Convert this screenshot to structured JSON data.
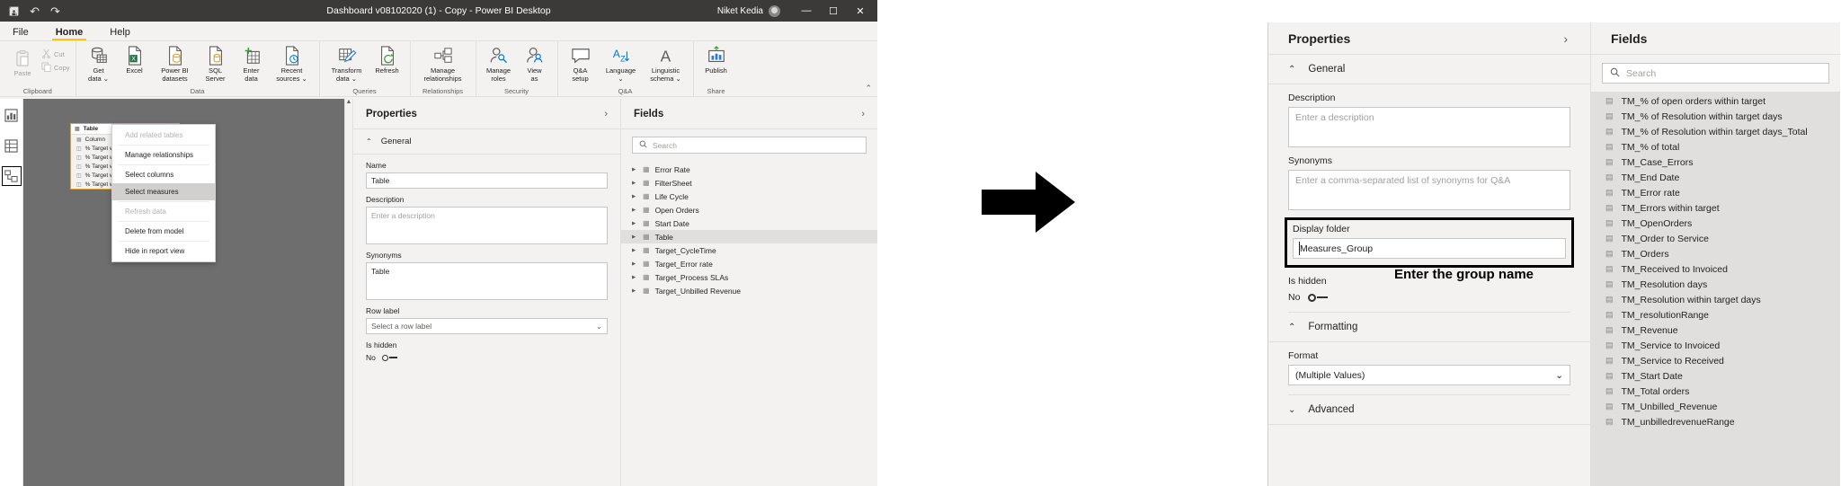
{
  "window": {
    "title": "Dashboard v08102020 (1) - Copy - Power BI Desktop",
    "user": "Niket Kedia",
    "quick_access": [
      "save-icon",
      "undo-icon",
      "redo-icon"
    ],
    "minimize": "—",
    "maximize": "☐",
    "close": "✕"
  },
  "menu": {
    "items": [
      "File",
      "Home",
      "Help"
    ],
    "active": "Home"
  },
  "ribbon": {
    "groups": [
      {
        "label": "Clipboard",
        "type": "clipboard",
        "paste": "Paste",
        "cut": "Cut",
        "copy": "Copy"
      },
      {
        "label": "Data",
        "buttons": [
          {
            "label": "Get\ndata ⌄",
            "icon": "get-data-icon"
          },
          {
            "label": "Excel",
            "icon": "excel-icon"
          },
          {
            "label": "Power BI\ndatasets",
            "icon": "powerbi-datasets-icon"
          },
          {
            "label": "SQL\nServer",
            "icon": "sql-server-icon"
          },
          {
            "label": "Enter\ndata",
            "icon": "enter-data-icon"
          },
          {
            "label": "Recent\nsources ⌄",
            "icon": "recent-sources-icon"
          }
        ]
      },
      {
        "label": "Queries",
        "buttons": [
          {
            "label": "Transform\ndata ⌄",
            "icon": "transform-data-icon"
          },
          {
            "label": "Refresh",
            "icon": "refresh-icon"
          }
        ]
      },
      {
        "label": "Relationships",
        "buttons": [
          {
            "label": "Manage\nrelationships",
            "icon": "manage-relationships-icon"
          }
        ]
      },
      {
        "label": "Security",
        "buttons": [
          {
            "label": "Manage\nroles",
            "icon": "manage-roles-icon"
          },
          {
            "label": "View\nas",
            "icon": "view-as-icon"
          }
        ]
      },
      {
        "label": "Q&A",
        "buttons": [
          {
            "label": "Q&A\nsetup",
            "icon": "qa-setup-icon"
          },
          {
            "label": "Language\n⌄",
            "icon": "language-icon"
          },
          {
            "label": "Linguistic\nschema ⌄",
            "icon": "linguistic-schema-icon"
          }
        ]
      },
      {
        "label": "Share",
        "buttons": [
          {
            "label": "Publish",
            "icon": "publish-icon"
          }
        ]
      }
    ],
    "collapse": "⌃"
  },
  "left_rail": {
    "items": [
      {
        "name": "report-view-icon",
        "glyph": "▤",
        "selected": false
      },
      {
        "name": "data-view-icon",
        "glyph": "▦",
        "selected": false
      },
      {
        "name": "model-view-icon",
        "glyph": "▧",
        "selected": true
      }
    ]
  },
  "model_card": {
    "title": "Table",
    "rows": [
      "Column",
      "% Target with",
      "% Target with",
      "% Target with",
      "% Target with",
      "% Target with"
    ]
  },
  "context_menu": {
    "items": [
      {
        "label": "Add related tables",
        "state": "disabled"
      },
      {
        "label": "Manage relationships",
        "state": "normal"
      },
      {
        "label": "Select columns",
        "state": "normal"
      },
      {
        "label": "Select measures",
        "state": "highlighted"
      },
      {
        "label": "Refresh data",
        "state": "disabled"
      },
      {
        "label": "Delete from model",
        "state": "normal"
      },
      {
        "label": "Hide in report view",
        "state": "normal"
      }
    ]
  },
  "left_properties": {
    "title": "Properties",
    "collapse_chevron": "›",
    "general_label": "General",
    "general_chevron": "⌃",
    "name_label": "Name",
    "name_value": "Table",
    "description_label": "Description",
    "description_placeholder": "Enter a description",
    "synonyms_label": "Synonyms",
    "synonyms_value": "Table",
    "row_label_label": "Row label",
    "row_label_value": "Select a row label",
    "row_label_chevron": "⌄",
    "is_hidden_label": "Is hidden",
    "is_hidden_value": "No"
  },
  "left_fields": {
    "title": "Fields",
    "collapse_chevron": "›",
    "search_placeholder": "Search",
    "search_icon": "search-icon",
    "items": [
      {
        "label": "Error Rate",
        "selected": false
      },
      {
        "label": "FilterSheet",
        "selected": false
      },
      {
        "label": "Life Cycle",
        "selected": false
      },
      {
        "label": "Open Orders",
        "selected": false
      },
      {
        "label": "Start Date",
        "selected": false
      },
      {
        "label": "Table",
        "selected": true
      },
      {
        "label": "Target_CycleTime",
        "selected": false
      },
      {
        "label": "Target_Error rate",
        "selected": false
      },
      {
        "label": "Target_Process SLAs",
        "selected": false
      },
      {
        "label": "Target_Unbilled Revenue",
        "selected": false
      }
    ]
  },
  "right_properties": {
    "title": "Properties",
    "collapse_chevron": "›",
    "general_label": "General",
    "general_chevron": "⌃",
    "description_label": "Description",
    "description_placeholder": "Enter a description",
    "synonyms_label": "Synonyms",
    "synonyms_placeholder": "Enter a comma-separated list of synonyms for Q&A",
    "display_folder_label": "Display folder",
    "display_folder_value": "Measures_Group",
    "is_hidden_label": "Is hidden",
    "is_hidden_value": "No",
    "formatting_label": "Formatting",
    "formatting_chevron": "⌃",
    "format_label": "Format",
    "format_value": "(Multiple Values)",
    "format_chevron": "⌄",
    "advanced_label": "Advanced",
    "advanced_chevron": "⌄"
  },
  "annotation": {
    "callout_text": "Enter the group name",
    "arrow_icon": "right-arrow-icon",
    "highlight_color": "#000000"
  },
  "right_fields": {
    "title": "Fields",
    "search_placeholder": "Search",
    "search_icon": "search-icon",
    "items": [
      "TM_% of open orders within target",
      "TM_% of Resolution within target days",
      "TM_% of Resolution within target days_Total",
      "TM_% of total",
      "TM_Case_Errors",
      "TM_End Date",
      "TM_Error rate",
      "TM_Errors within target",
      "TM_OpenOrders",
      "TM_Order to Service",
      "TM_Orders",
      "TM_Received to Invoiced",
      "TM_Resolution days",
      "TM_Resolution within target days",
      "TM_resolutionRange",
      "TM_Revenue",
      "TM_Service to Invoiced",
      "TM_Service to Received",
      "TM_Start Date",
      "TM_Total orders",
      "TM_Unbilled_Revenue",
      "TM_unbilledrevenueRange"
    ]
  }
}
